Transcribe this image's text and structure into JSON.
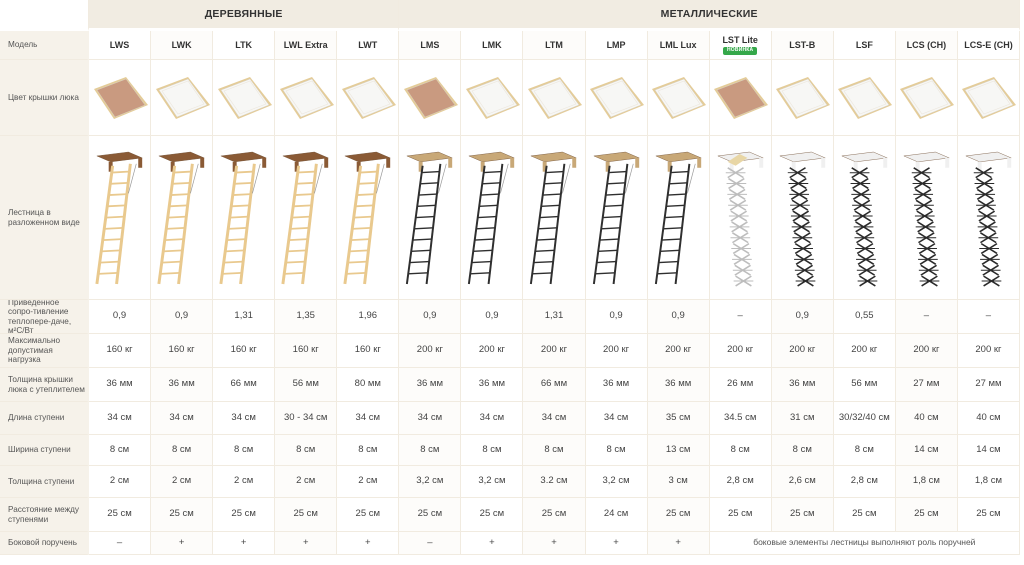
{
  "groups": {
    "wood": "ДЕРЕВЯННЫЕ",
    "metal": "МЕТАЛЛИЧЕСКИЕ"
  },
  "row_labels": {
    "model": "Модель",
    "lid_color": "Цвет крышки люка",
    "ladder_view": "Лестница в разложенном виде",
    "resistance": "Приведенное сопро-тивление теплопере-даче, м²С/Вт",
    "max_load": "Максимально допустимая нагрузка",
    "lid_thickness": "Толщина крышки люка с утеплителем",
    "step_length": "Длина ступени",
    "step_width": "Ширина ступени",
    "step_thickness": "Толщина ступени",
    "step_distance": "Расстояние между ступенями",
    "handrail": "Боковой поручень"
  },
  "handrail_note": "боковые элементы лестницы выполняют роль поручней",
  "new_badge": "НОВИНКА",
  "colors": {
    "lid_wood": "#c99a80",
    "lid_white": "#f7f7f5",
    "lid_frame": "#e4cc98",
    "wood": "#e9c98e",
    "metal": "#2f2f2f",
    "badge": "#35a84a"
  },
  "models": [
    {
      "name": "LWS",
      "lid": "wood",
      "ladder": "wood",
      "resistance": "0,9",
      "load": "160 кг",
      "lid_thick": "36 мм",
      "step_len": "34 см",
      "step_w": "8 см",
      "step_t": "2 см",
      "dist": "25 см",
      "rail": "–"
    },
    {
      "name": "LWK",
      "lid": "white",
      "ladder": "wood",
      "resistance": "0,9",
      "load": "160 кг",
      "lid_thick": "36 мм",
      "step_len": "34 см",
      "step_w": "8 см",
      "step_t": "2 см",
      "dist": "25 см",
      "rail": "+"
    },
    {
      "name": "LTK",
      "lid": "white",
      "ladder": "wood",
      "resistance": "1,31",
      "load": "160 кг",
      "lid_thick": "66 мм",
      "step_len": "34 см",
      "step_w": "8 см",
      "step_t": "2 см",
      "dist": "25 см",
      "rail": "+"
    },
    {
      "name": "LWL Extra",
      "lid": "white",
      "ladder": "wood",
      "resistance": "1,35",
      "load": "160 кг",
      "lid_thick": "56 мм",
      "step_len": "30 - 34 см",
      "step_w": "8 см",
      "step_t": "2 см",
      "dist": "25 см",
      "rail": "+"
    },
    {
      "name": "LWT",
      "lid": "white",
      "ladder": "wood",
      "resistance": "1,96",
      "load": "160 кг",
      "lid_thick": "80 мм",
      "step_len": "34 см",
      "step_w": "8 см",
      "step_t": "2 см",
      "dist": "25 см",
      "rail": "+"
    },
    {
      "name": "LMS",
      "lid": "wood",
      "ladder": "metal",
      "resistance": "0,9",
      "load": "200 кг",
      "lid_thick": "36 мм",
      "step_len": "34 см",
      "step_w": "8 см",
      "step_t": "3,2 см",
      "dist": "25 см",
      "rail": "–"
    },
    {
      "name": "LMK",
      "lid": "white",
      "ladder": "metal",
      "resistance": "0,9",
      "load": "200 кг",
      "lid_thick": "36 мм",
      "step_len": "34 см",
      "step_w": "8 см",
      "step_t": "3,2 см",
      "dist": "25 см",
      "rail": "+"
    },
    {
      "name": "LTM",
      "lid": "white",
      "ladder": "metal",
      "resistance": "1,31",
      "load": "200 кг",
      "lid_thick": "66 мм",
      "step_len": "34 см",
      "step_w": "8 см",
      "step_t": "3.2 см",
      "dist": "25 см",
      "rail": "+"
    },
    {
      "name": "LMP",
      "lid": "white",
      "ladder": "metal",
      "resistance": "0,9",
      "load": "200 кг",
      "lid_thick": "36 мм",
      "step_len": "34 см",
      "step_w": "8 см",
      "step_t": "3,2 см",
      "dist": "24 см",
      "rail": "+"
    },
    {
      "name": "LML Lux",
      "lid": "white",
      "ladder": "metal",
      "resistance": "0,9",
      "load": "200 кг",
      "lid_thick": "36 мм",
      "step_len": "35 см",
      "step_w": "13 см",
      "step_t": "3 см",
      "dist": "25 см",
      "rail": "+"
    },
    {
      "name": "LST Lite",
      "lid": "wood",
      "ladder": "scissor-light",
      "resistance": "–",
      "load": "200 кг",
      "lid_thick": "26 мм",
      "step_len": "34.5 см",
      "step_w": "8 см",
      "step_t": "2,8 см",
      "dist": "25 см",
      "rail": "",
      "is_new": true
    },
    {
      "name": "LST-B",
      "lid": "white",
      "ladder": "scissor",
      "resistance": "0,9",
      "load": "200 кг",
      "lid_thick": "36 мм",
      "step_len": "31 см",
      "step_w": "8 см",
      "step_t": "2,6 см",
      "dist": "25 см",
      "rail": ""
    },
    {
      "name": "LSF",
      "lid": "white",
      "ladder": "scissor",
      "resistance": "0,55",
      "load": "200 кг",
      "lid_thick": "56 мм",
      "step_len": "30/32/40 см",
      "step_w": "8 см",
      "step_t": "2,8 см",
      "dist": "25 см",
      "rail": ""
    },
    {
      "name": "LCS (CH)",
      "lid": "white",
      "ladder": "scissor",
      "resistance": "–",
      "load": "200 кг",
      "lid_thick": "27 мм",
      "step_len": "40 см",
      "step_w": "14 см",
      "step_t": "1,8 см",
      "dist": "25 см",
      "rail": ""
    },
    {
      "name": "LCS-E (CH)",
      "lid": "white",
      "ladder": "scissor",
      "resistance": "–",
      "load": "200 кг",
      "lid_thick": "27 мм",
      "step_len": "40 см",
      "step_w": "14 см",
      "step_t": "1,8 см",
      "dist": "25 см",
      "rail": ""
    }
  ]
}
